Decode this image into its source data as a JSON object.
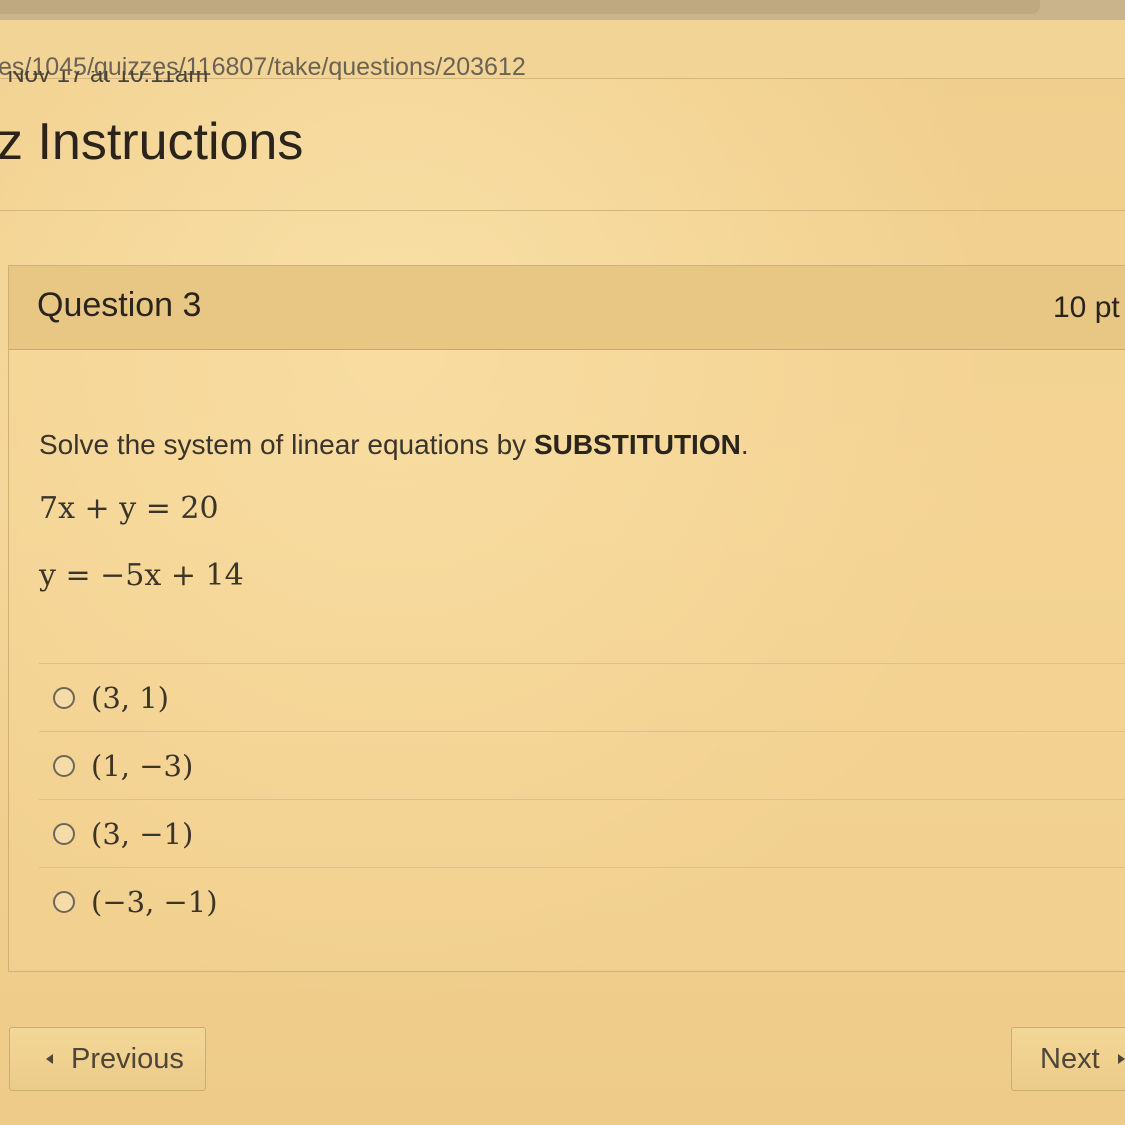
{
  "browser": {
    "url_fragment": "es/1045/quizzes/116807/take/questions/203612"
  },
  "quiz": {
    "clipped_meta_line": ": Nov 17 at 10:11am",
    "title": "z Instructions"
  },
  "question": {
    "label": "Question 3",
    "points": "10 pt",
    "prompt_prefix": "Solve the system of linear equations by ",
    "prompt_emphasis": "SUBSTITUTION",
    "prompt_suffix": ".",
    "equations": [
      "7x + y = 20",
      "y = −5x + 14"
    ],
    "answers": [
      "(3, 1)",
      "(1, −3)",
      "(3, −1)",
      "(−3, −1)"
    ]
  },
  "navigation": {
    "previous_label": "Previous",
    "next_label": "Next"
  },
  "colors": {
    "background": "#f2d08f",
    "header_band": "#e8c683",
    "text": "#2f2a22"
  }
}
